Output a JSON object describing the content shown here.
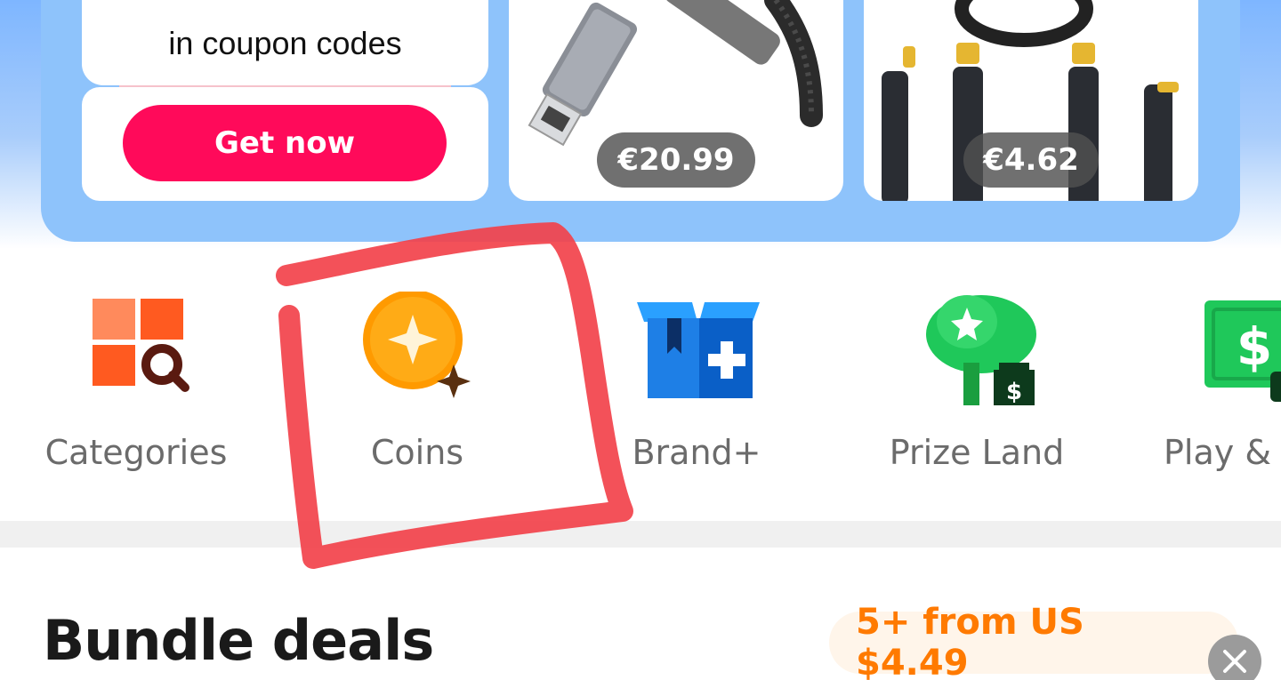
{
  "coupon": {
    "text": "in coupon codes",
    "button_label": "Get now"
  },
  "products": [
    {
      "price": "€20.99"
    },
    {
      "price": "€4.62"
    }
  ],
  "nav": [
    {
      "label": "Categories",
      "icon": "categories-icon"
    },
    {
      "label": "Coins",
      "icon": "coin-icon"
    },
    {
      "label": "Brand+",
      "icon": "brand-plus-icon"
    },
    {
      "label": "Prize Land",
      "icon": "prize-tree-icon"
    },
    {
      "label": "Play & I",
      "icon": "cash-icon"
    }
  ],
  "bundle": {
    "title": "Bundle deals",
    "link_label": "5+ from US $4.49",
    "chevron": "›"
  },
  "colors": {
    "accent_pink": "#ff0a5a",
    "panel_blue": "#8ec3fb",
    "annotation_red": "#f2424b",
    "bundle_orange": "#ff7a00"
  }
}
